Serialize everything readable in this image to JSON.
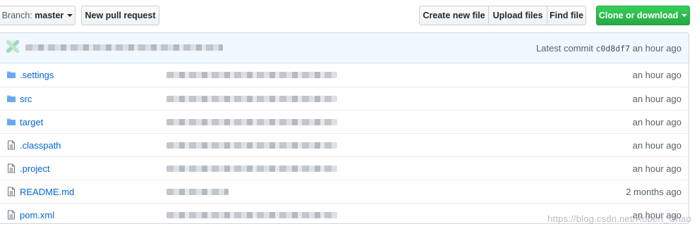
{
  "toolbar": {
    "branch_label": "Branch:",
    "branch_value": "master",
    "new_pr_label": "New pull request",
    "create_label": "Create new file",
    "upload_label": "Upload files",
    "find_label": "Find file",
    "clone_label": "Clone or download"
  },
  "commit": {
    "latest_label": "Latest commit",
    "sha": "c0d8df7",
    "age": "an hour ago"
  },
  "files": [
    {
      "name": ".settings",
      "type": "folder",
      "age": "an hour ago"
    },
    {
      "name": "src",
      "type": "folder",
      "age": "an hour ago"
    },
    {
      "name": "target",
      "type": "folder",
      "age": "an hour ago"
    },
    {
      "name": ".classpath",
      "type": "file",
      "age": "an hour ago"
    },
    {
      "name": ".project",
      "type": "file",
      "age": "an hour ago"
    },
    {
      "name": "README.md",
      "type": "file",
      "age": "2 months ago"
    },
    {
      "name": "pom.xml",
      "type": "file",
      "age": "an hour ago"
    }
  ],
  "watermark": "https://blog.csdn.net/Robert_Chao",
  "colors": {
    "link": "#0366d6",
    "clone_button": "#28a745",
    "commit_bar": "#f1f8ff",
    "icon": "#79b8ff"
  }
}
